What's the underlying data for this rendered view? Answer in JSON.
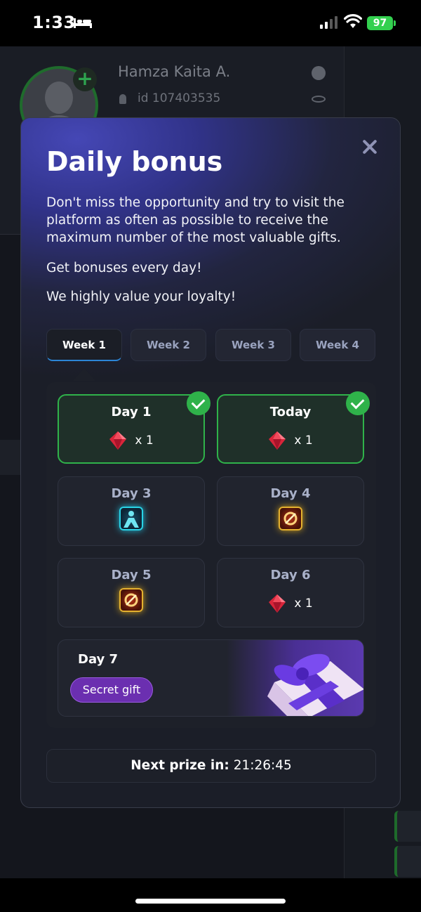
{
  "status_bar": {
    "time": "1:33",
    "battery": "97"
  },
  "background": {
    "profile_name": "Hamza Kaita A.",
    "profile_id": "id 107403535"
  },
  "modal": {
    "title": "Daily bonus",
    "paragraph1": "Don't miss the opportunity and try to visit the platform as often as possible to receive the maximum number of the most valuable gifts.",
    "paragraph2": "Get bonuses every day!",
    "paragraph3": "We highly value your loyalty!",
    "tabs": [
      {
        "label": "Week 1",
        "active": true
      },
      {
        "label": "Week 2",
        "active": false
      },
      {
        "label": "Week 3",
        "active": false
      },
      {
        "label": "Week 4",
        "active": false
      }
    ],
    "days": [
      {
        "label": "Day 1",
        "status": "claimed",
        "reward": "gem-icon",
        "quantity": "x 1"
      },
      {
        "label": "Today",
        "status": "claimed",
        "reward": "gem-icon",
        "quantity": "x 1"
      },
      {
        "label": "Day 3",
        "status": "locked",
        "reward": "avatar-item-icon",
        "quantity": ""
      },
      {
        "label": "Day 4",
        "status": "locked",
        "reward": "booster-item-icon",
        "quantity": ""
      },
      {
        "label": "Day 5",
        "status": "locked",
        "reward": "booster-item-icon",
        "quantity": ""
      },
      {
        "label": "Day 6",
        "status": "locked",
        "reward": "gem-icon",
        "quantity": "x 1"
      }
    ],
    "day7": {
      "label": "Day 7",
      "badge": "Secret gift"
    },
    "next_prize": {
      "label": "Next prize in:",
      "value": "21:26:45"
    }
  },
  "colors": {
    "accent_green": "#2fb24a",
    "tab_active_underline": "#2c86d6",
    "secret_gift_purple": "#6b2fb0",
    "modal_gradient": "#4547b5"
  }
}
